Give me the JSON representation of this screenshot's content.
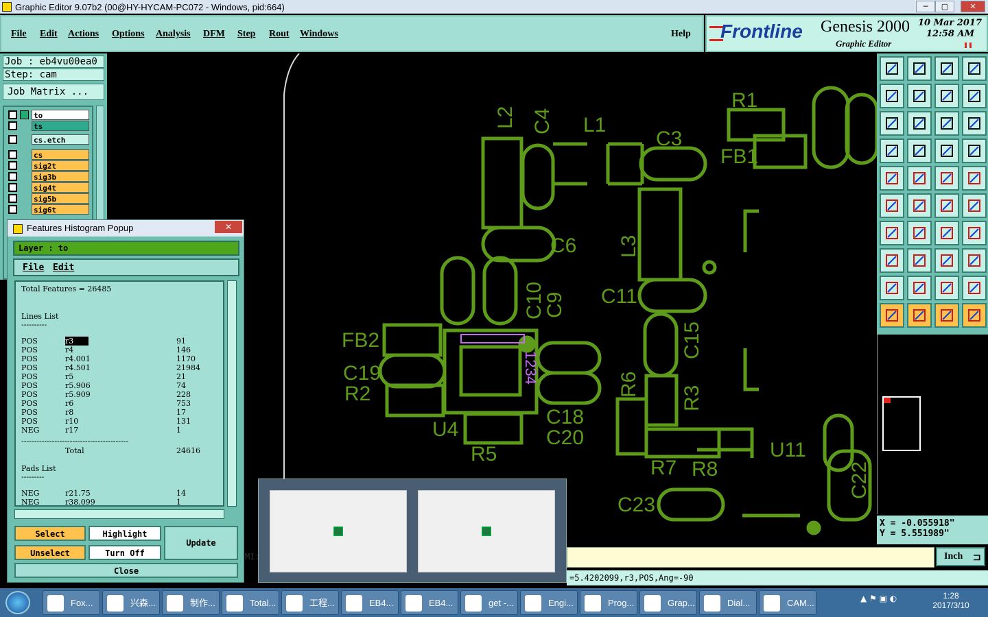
{
  "window": {
    "title": "Graphic Editor 9.07b2 (00@HY-HYCAM-PC072 - Windows, pid:664)",
    "min": "─",
    "max": "▢",
    "close": "✕"
  },
  "menu": {
    "items": [
      "File",
      "Edit",
      "Actions",
      "Options",
      "Analysis",
      "DFM",
      "Step",
      "Rout",
      "Windows"
    ],
    "help": "Help"
  },
  "brand": {
    "logo": "Frontline",
    "product": "Genesis 2000",
    "subtitle": "Graphic Editor",
    "date": "10 Mar 2017",
    "time": "12:58 AM"
  },
  "job": {
    "job": "Job : eb4vu00ea0",
    "step": "Step: cam",
    "matrix": "Job Matrix ..."
  },
  "layers": [
    {
      "name": "to",
      "color": "#ffffff"
    },
    {
      "name": "ts",
      "color": "#2eaa8e"
    },
    {
      "name": "cs.etch",
      "color": "#c6f2e8"
    },
    {
      "name": "cs",
      "color": "#ffc34d"
    },
    {
      "name": "sig2t",
      "color": "#ffc34d"
    },
    {
      "name": "sig3b",
      "color": "#ffc34d"
    },
    {
      "name": "sig4t",
      "color": "#ffc34d"
    },
    {
      "name": "sig5b",
      "color": "#ffc34d"
    },
    {
      "name": "sig6t",
      "color": "#ffc34d"
    }
  ],
  "popup": {
    "title": "Features Histogram Popup",
    "layer_label": "Layer :  to",
    "menu": [
      "File",
      "Edit"
    ],
    "total_features": "Total Features = 26485",
    "lines_header": "Lines List",
    "lines": [
      {
        "pol": "POS",
        "sym": "r3",
        "count": "91"
      },
      {
        "pol": "POS",
        "sym": "r4",
        "count": "146"
      },
      {
        "pol": "POS",
        "sym": "r4.001",
        "count": "1170"
      },
      {
        "pol": "POS",
        "sym": "r4.501",
        "count": "21984"
      },
      {
        "pol": "POS",
        "sym": "r5",
        "count": "21"
      },
      {
        "pol": "POS",
        "sym": "r5.906",
        "count": "74"
      },
      {
        "pol": "POS",
        "sym": "r5.909",
        "count": "228"
      },
      {
        "pol": "POS",
        "sym": "r6",
        "count": "753"
      },
      {
        "pol": "POS",
        "sym": "r8",
        "count": "17"
      },
      {
        "pol": "POS",
        "sym": "r10",
        "count": "131"
      },
      {
        "pol": "NEG",
        "sym": "r17",
        "count": "1"
      }
    ],
    "total_label": "Total",
    "total_value": "24616",
    "pads_header": "Pads List",
    "pads": [
      {
        "pol": "NEG",
        "sym": "r21.75",
        "count": "14"
      },
      {
        "pol": "NEG",
        "sym": "r38.099",
        "count": "1"
      }
    ],
    "buttons": {
      "select": "Select",
      "highlight": "Highlight",
      "update": "Update",
      "unselect": "Unselect",
      "turnoff": "Turn Off",
      "close": "Close"
    }
  },
  "coords": {
    "x": "X = -0.055918\"",
    "y": "Y = 5.551989\""
  },
  "cmd": {
    "prefix": "M1:",
    "unit": "Inch"
  },
  "status": "=5.4202099,r3,POS,Ang=-90",
  "pcb": {
    "labels": [
      "R1",
      "L2",
      "C4",
      "L1",
      "C3",
      "FB1",
      "C6",
      "L3",
      "C10",
      "C9",
      "C11",
      "FB2",
      "C19",
      "R2",
      "U4",
      "R5",
      "C15",
      "R6",
      "R3",
      "C18",
      "C20",
      "R7",
      "R8",
      "U11",
      "C23",
      "C22"
    ],
    "chip_text": "1234"
  },
  "taskbar": {
    "items": [
      "Fox...",
      "兴森...",
      "制作...",
      "Total...",
      "工程...",
      "EB4...",
      "EB4...",
      "get -...",
      "Engi...",
      "Prog...",
      "Grap...",
      "Dial...",
      "CAM..."
    ],
    "time": "1:28",
    "date": "2017/3/10"
  }
}
